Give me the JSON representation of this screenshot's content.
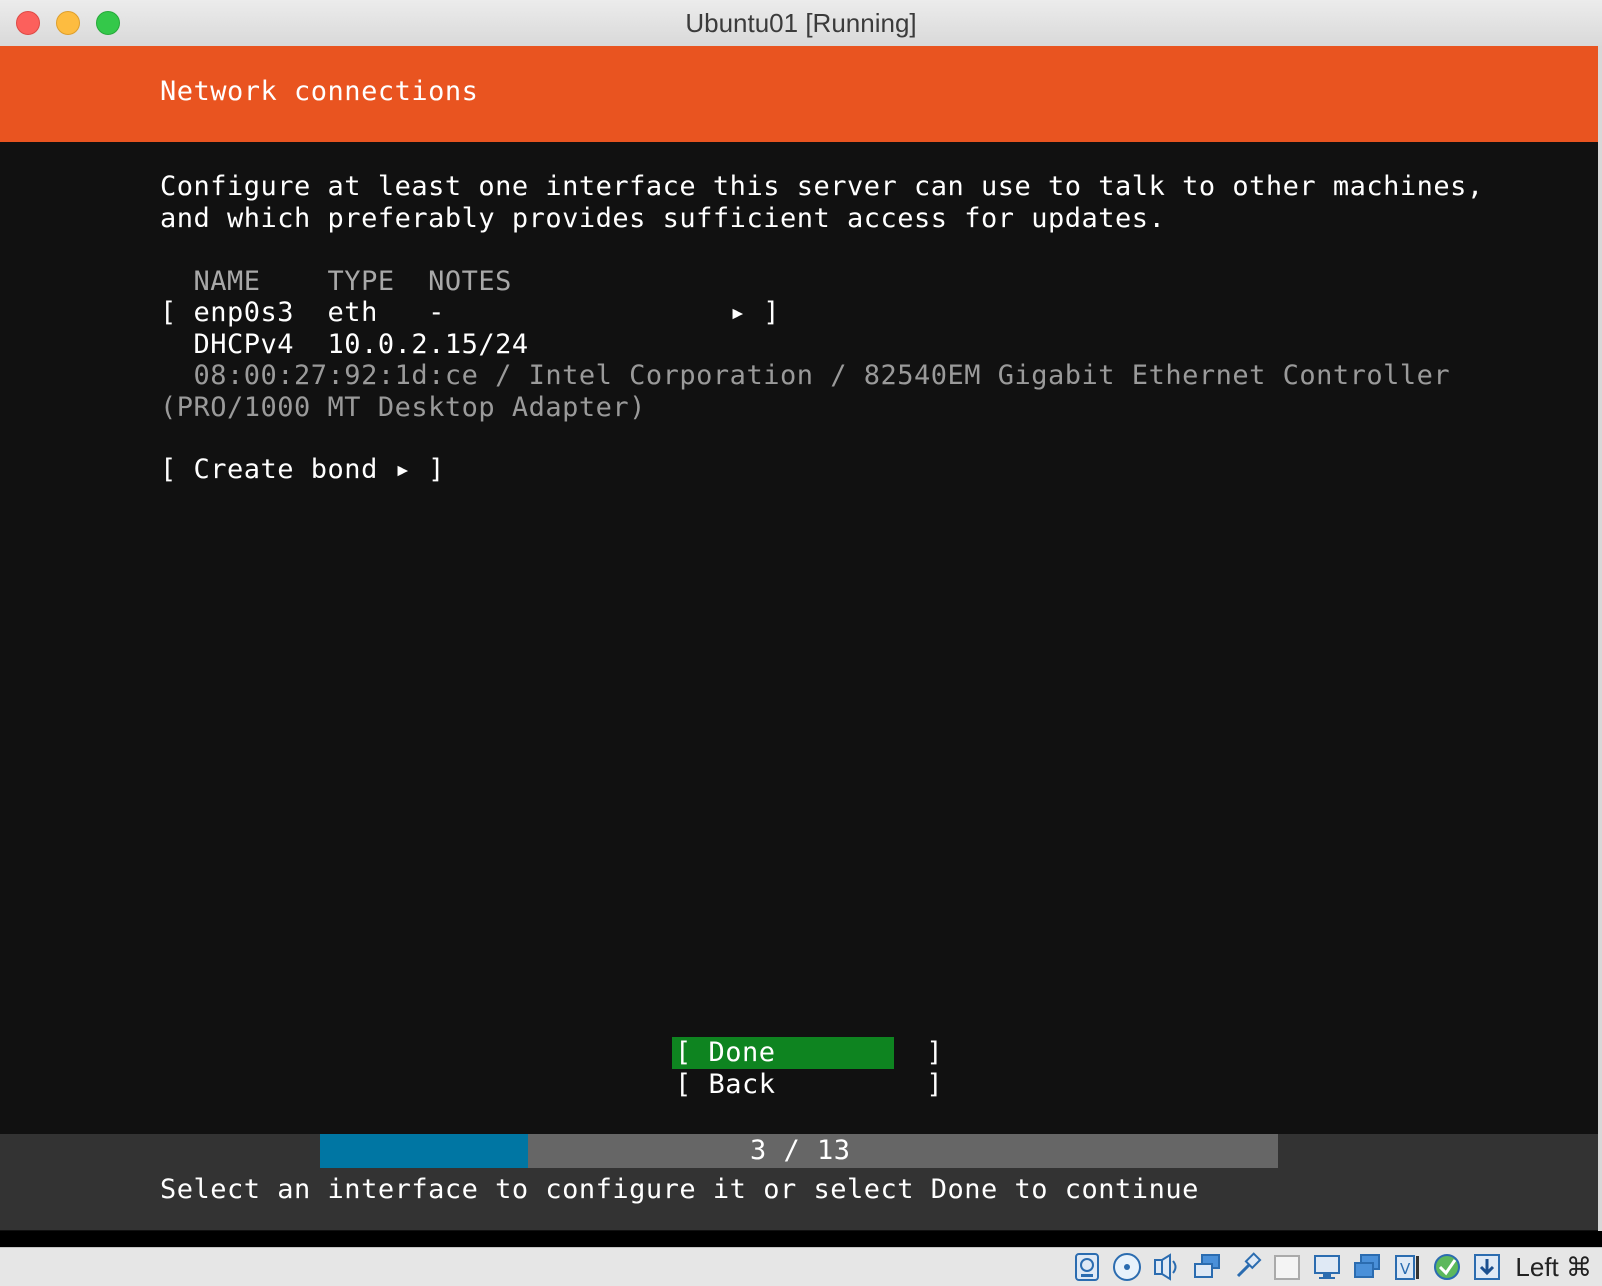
{
  "window": {
    "title": "Ubuntu01 [Running]"
  },
  "installer": {
    "header_title": "Network connections",
    "description_line1": "Configure at least one interface this server can use to talk to other machines,",
    "description_line2": "and which preferably provides sufficient access for updates.",
    "table_header": "  NAME    TYPE  NOTES",
    "interfaces": [
      {
        "row": "[ enp0s3  eth   -                 ▸ ]",
        "dhcp": "  DHCPv4  10.0.2.15/24",
        "hw_line1": "  08:00:27:92:1d:ce / Intel Corporation / 82540EM Gigabit Ethernet Controller",
        "hw_line2": "(PRO/1000 MT Desktop Adapter)"
      }
    ],
    "create_bond": "[ Create bond ▸ ]",
    "done_button": "[ Done         ]",
    "back_button": "[ Back         ]",
    "progress": {
      "text": "3 / 13",
      "current": 3,
      "total": 13,
      "fill_fraction": 0.217
    },
    "footer_hint": "Select an interface to configure it or select Done to continue"
  },
  "statusbar": {
    "host_key": "Left ⌘",
    "icons": [
      "hard-disk-icon",
      "optical-disc-icon",
      "audio-icon",
      "network-icon",
      "usb-icon",
      "shared-folder-icon",
      "display-icon",
      "screen-icon",
      "video-capture-icon",
      "cpu-virtualization-icon",
      "mouse-integration-icon",
      "download-icon"
    ]
  },
  "colors": {
    "ubuntu_orange": "#e95420",
    "done_green": "#0e8420",
    "progress_blue": "#0076a3"
  }
}
